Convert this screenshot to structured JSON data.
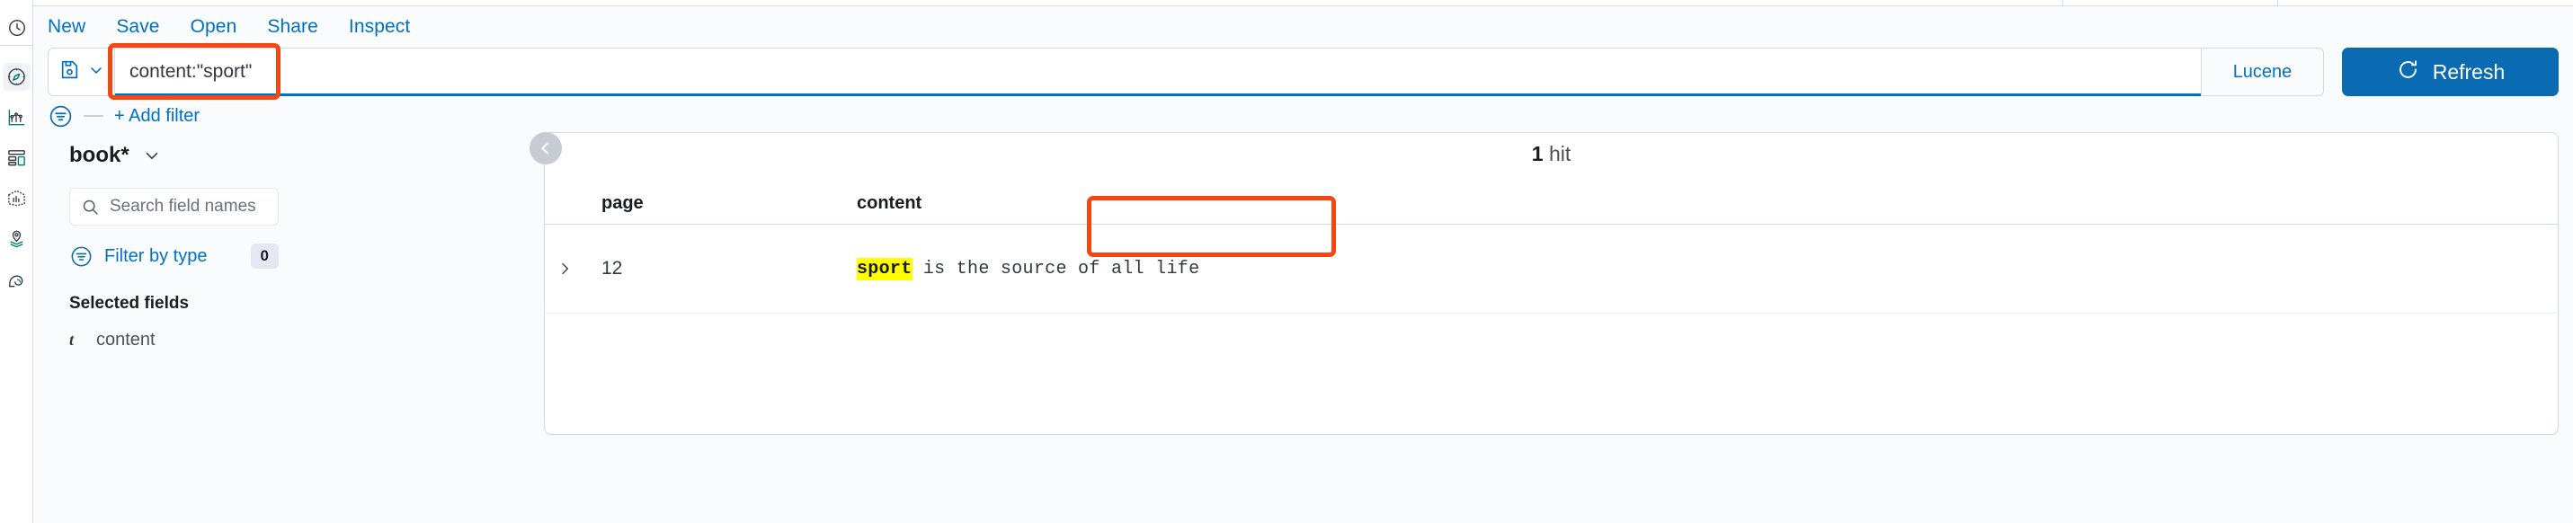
{
  "app": {
    "name": "Discover"
  },
  "top_nav": {
    "items": [
      {
        "label": "New",
        "name": "nav-new"
      },
      {
        "label": "Save",
        "name": "nav-save"
      },
      {
        "label": "Open",
        "name": "nav-open"
      },
      {
        "label": "Share",
        "name": "nav-share"
      },
      {
        "label": "Inspect",
        "name": "nav-inspect"
      }
    ]
  },
  "query_bar": {
    "query_value": "content:\"sport\"",
    "query_placeholder": "Search",
    "language_label": "Lucene",
    "refresh_label": "Refresh",
    "saved_query_icon": "save-disk-icon",
    "saved_query_chevron": "chevron-down-icon",
    "refresh_icon": "refresh-icon",
    "focused": true
  },
  "filter_bar": {
    "filter_icon": "filter-funnel-icon",
    "add_filter_label": "+ Add filter"
  },
  "sidebar": {
    "index_pattern": "book*",
    "index_pattern_chevron": "chevron-down-icon",
    "field_search_placeholder": "Search field names",
    "field_search_value": "",
    "field_search_icon": "search-icon",
    "filter_by_type_label": "Filter by type",
    "filter_by_type_icon": "filter-funnel-icon",
    "filter_by_type_count": "0",
    "selected_fields_title": "Selected fields",
    "selected_fields": [
      {
        "name": "content",
        "type_glyph": "t"
      }
    ]
  },
  "results": {
    "hit_count": "1",
    "hit_label": "hit",
    "collapse_icon": "chevron-left-circle-icon",
    "expand_row_icon": "chevron-right-icon",
    "columns": [
      "page",
      "content"
    ],
    "rows": [
      {
        "page": "12",
        "content_highlight": "sport",
        "content_rest": " is the source of all life"
      }
    ]
  },
  "icon_rail": {
    "items": [
      {
        "name": "recently-viewed-clock-icon",
        "active": false
      },
      {
        "name": "discover-compass-icon",
        "active": true
      },
      {
        "name": "visualize-chart-icon",
        "active": false
      },
      {
        "name": "dashboard-icon",
        "active": false
      },
      {
        "name": "canvas-icon",
        "active": false
      },
      {
        "name": "maps-pin-layers-icon",
        "active": false
      },
      {
        "name": "machine-learning-icon",
        "active": false
      }
    ]
  },
  "annotations": {
    "query_box": {
      "name": "annotation-query-highlight",
      "color": "#f44711"
    },
    "content_cell": {
      "name": "annotation-content-highlight",
      "color": "#f44711"
    }
  },
  "colors": {
    "accent_blue": "#0071c2",
    "primary_button": "#0a6bb2",
    "annotation": "#f44711",
    "highlight_yellow": "#ffff00",
    "text_dark": "#1a1c21",
    "border": "#d3dae6",
    "page_bg": "#fafbfd"
  }
}
